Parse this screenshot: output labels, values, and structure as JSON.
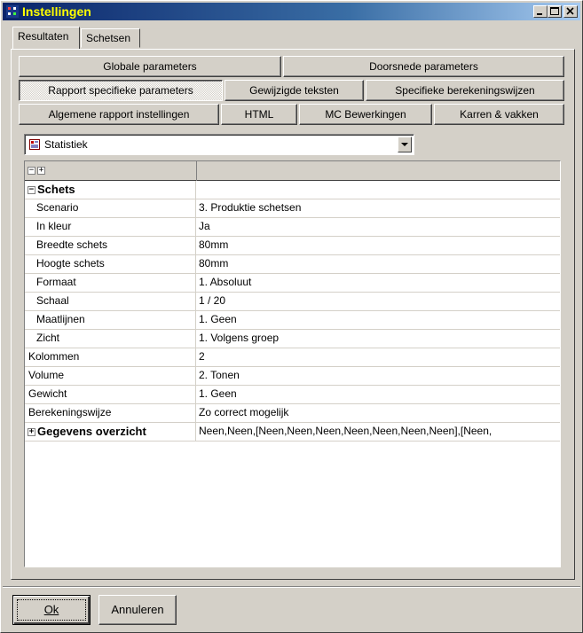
{
  "window": {
    "title": "Instellingen"
  },
  "tabs": [
    {
      "label": "Resultaten",
      "active": true
    },
    {
      "label": "Schetsen",
      "active": false
    }
  ],
  "buttons": {
    "row1": [
      "Globale parameters",
      "Doorsnede parameters"
    ],
    "row2": [
      "Rapport specifieke parameters",
      "Gewijzigde teksten",
      "Specifieke berekeningswijzen"
    ],
    "row3": [
      "Algemene rapport instellingen",
      "HTML",
      "MC Bewerkingen",
      "Karren & vakken"
    ],
    "selected": "Rapport specifieke parameters"
  },
  "combo": {
    "value": "Statistiek",
    "icon": "report-icon"
  },
  "grid": {
    "header_icons": [
      "collapse-all-icon",
      "expand-all-icon"
    ],
    "rows": [
      {
        "key": "Schets",
        "value": "",
        "level": 0,
        "bold": true,
        "expander": "−"
      },
      {
        "key": "Scenario",
        "value": "3. Produktie schetsen",
        "level": 1
      },
      {
        "key": "In kleur",
        "value": "Ja",
        "level": 1
      },
      {
        "key": "Breedte schets",
        "value": "80mm",
        "level": 1
      },
      {
        "key": "Hoogte schets",
        "value": "80mm",
        "level": 1
      },
      {
        "key": "Formaat",
        "value": "1. Absoluut",
        "level": 1
      },
      {
        "key": "Schaal",
        "value": "1 / 20",
        "level": 1
      },
      {
        "key": "Maatlijnen",
        "value": "1. Geen",
        "level": 1
      },
      {
        "key": "Zicht",
        "value": "1. Volgens groep",
        "level": 1
      },
      {
        "key": "Kolommen",
        "value": "2",
        "level": 0
      },
      {
        "key": "Volume",
        "value": "2. Tonen",
        "level": 0
      },
      {
        "key": "Gewicht",
        "value": "1. Geen",
        "level": 0
      },
      {
        "key": "Berekeningswijze",
        "value": "Zo correct mogelijk",
        "level": 0
      },
      {
        "key": "Gegevens overzicht",
        "value": "Neen,Neen,[Neen,Neen,Neen,Neen,Neen,Neen,Neen],[Neen,",
        "level": 0,
        "bold": true,
        "expander": "+"
      }
    ]
  },
  "dialog": {
    "ok_label": "Ok",
    "cancel_label": "Annuleren"
  }
}
